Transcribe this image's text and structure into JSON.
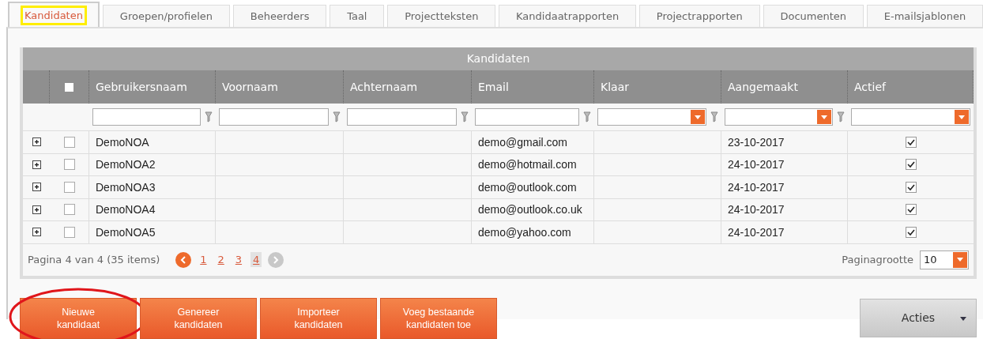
{
  "tabs": [
    {
      "label": "Kandidaten",
      "selected": true,
      "highlighted": true
    },
    {
      "label": "Groepen/profielen",
      "selected": false,
      "highlighted": false
    },
    {
      "label": "Beheerders",
      "selected": false,
      "highlighted": false
    },
    {
      "label": "Taal",
      "selected": false,
      "highlighted": false
    },
    {
      "label": "Projectteksten",
      "selected": false,
      "highlighted": false
    },
    {
      "label": "Kandidaatrapporten",
      "selected": false,
      "highlighted": false
    },
    {
      "label": "Projectrapporten",
      "selected": false,
      "highlighted": false
    },
    {
      "label": "Documenten",
      "selected": false,
      "highlighted": false
    },
    {
      "label": "E-mailsjablonen",
      "selected": false,
      "highlighted": false
    }
  ],
  "grid": {
    "title": "Kandidaten",
    "select_all_checked": false,
    "columns": [
      {
        "label": "Gebruikersnaam",
        "kind": "text"
      },
      {
        "label": "Voornaam",
        "kind": "text"
      },
      {
        "label": "Achternaam",
        "kind": "text"
      },
      {
        "label": "Email",
        "kind": "text"
      },
      {
        "label": "Klaar",
        "kind": "dropdown"
      },
      {
        "label": "Aangemaakt",
        "kind": "dropdown"
      },
      {
        "label": "Actief",
        "kind": "dropdown-nofilter"
      }
    ],
    "rows": [
      {
        "expanded": false,
        "checked": false,
        "username": "DemoNOA",
        "email": "demo@gmail.com",
        "created": "23-10-2017",
        "active": true
      },
      {
        "expanded": false,
        "checked": false,
        "username": "DemoNOA2",
        "email": "demo@hotmail.com",
        "created": "24-10-2017",
        "active": true
      },
      {
        "expanded": false,
        "checked": false,
        "username": "DemoNOA3",
        "email": "demo@outlook.com",
        "created": "24-10-2017",
        "active": true
      },
      {
        "expanded": false,
        "checked": false,
        "username": "DemoNOA4",
        "email": "demo@outlook.co.uk",
        "created": "24-10-2017",
        "active": true
      },
      {
        "expanded": false,
        "checked": false,
        "username": "DemoNOA5",
        "email": "demo@yahoo.com",
        "created": "24-10-2017",
        "active": true
      }
    ],
    "pager": {
      "summary": "Pagina 4 van 4 (35 items)",
      "prev_enabled": true,
      "next_enabled": false,
      "pages": [
        {
          "label": "1",
          "selected": false
        },
        {
          "label": "2",
          "selected": false
        },
        {
          "label": "3",
          "selected": false
        },
        {
          "label": "4",
          "selected": true
        }
      ],
      "page_size_label": "Paginagrootte",
      "page_size": "10"
    }
  },
  "buttons": [
    {
      "label": "Nieuwe kandidaat",
      "circled": true
    },
    {
      "label": "Genereer kandidaten",
      "circled": false
    },
    {
      "label": "Importeer kandidaten",
      "circled": false
    },
    {
      "label": "Voeg bestaande kandidaten toe",
      "circled": false
    }
  ],
  "actions_button": {
    "label": "Acties"
  }
}
